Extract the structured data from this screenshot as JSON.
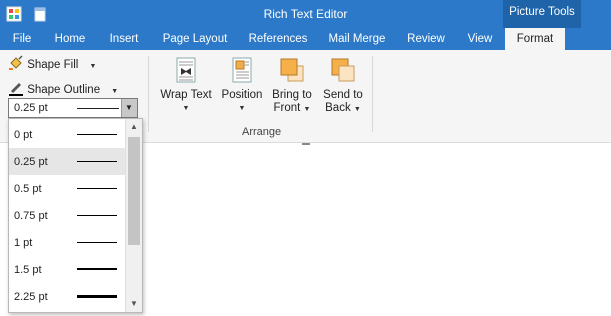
{
  "window": {
    "title": "Rich Text Editor",
    "context_tab_group": "Picture Tools"
  },
  "tabs": [
    {
      "label": "File"
    },
    {
      "label": "Home"
    },
    {
      "label": "Insert"
    },
    {
      "label": "Page Layout"
    },
    {
      "label": "References"
    },
    {
      "label": "Mail Merge"
    },
    {
      "label": "Review"
    },
    {
      "label": "View"
    },
    {
      "label": "Format",
      "active": true
    }
  ],
  "ribbon": {
    "shape_fill": "Shape Fill",
    "shape_outline": "Shape Outline",
    "outline_weight": {
      "value": "0.25 pt"
    },
    "arrange": {
      "wrap_text": "Wrap Text",
      "position": "Position",
      "bring_to_front_1": "Bring to",
      "bring_to_front_2": "Front",
      "send_to_back_1": "Send to",
      "send_to_back_2": "Back",
      "group_label": "Arrange"
    }
  },
  "dropdown": {
    "items": [
      {
        "label": "0 pt",
        "weight": 1
      },
      {
        "label": "0.25 pt",
        "weight": 1,
        "selected": true
      },
      {
        "label": "0.5 pt",
        "weight": 1
      },
      {
        "label": "0.75 pt",
        "weight": 1
      },
      {
        "label": "1 pt",
        "weight": 1
      },
      {
        "label": "1.5 pt",
        "weight": 2
      },
      {
        "label": "2.25 pt",
        "weight": 3
      }
    ]
  },
  "colors": {
    "title_bar": "#2b79c8",
    "context_tab": "#1f63a8",
    "ribbon_bg": "#f5f5f5",
    "selected_item": "#e6e6e6"
  },
  "icons": [
    "app-icon",
    "document-icon",
    "paint-bucket-icon",
    "pen-outline-icon",
    "wrap-text-icon",
    "position-icon",
    "bring-to-front-icon",
    "send-to-back-icon"
  ]
}
